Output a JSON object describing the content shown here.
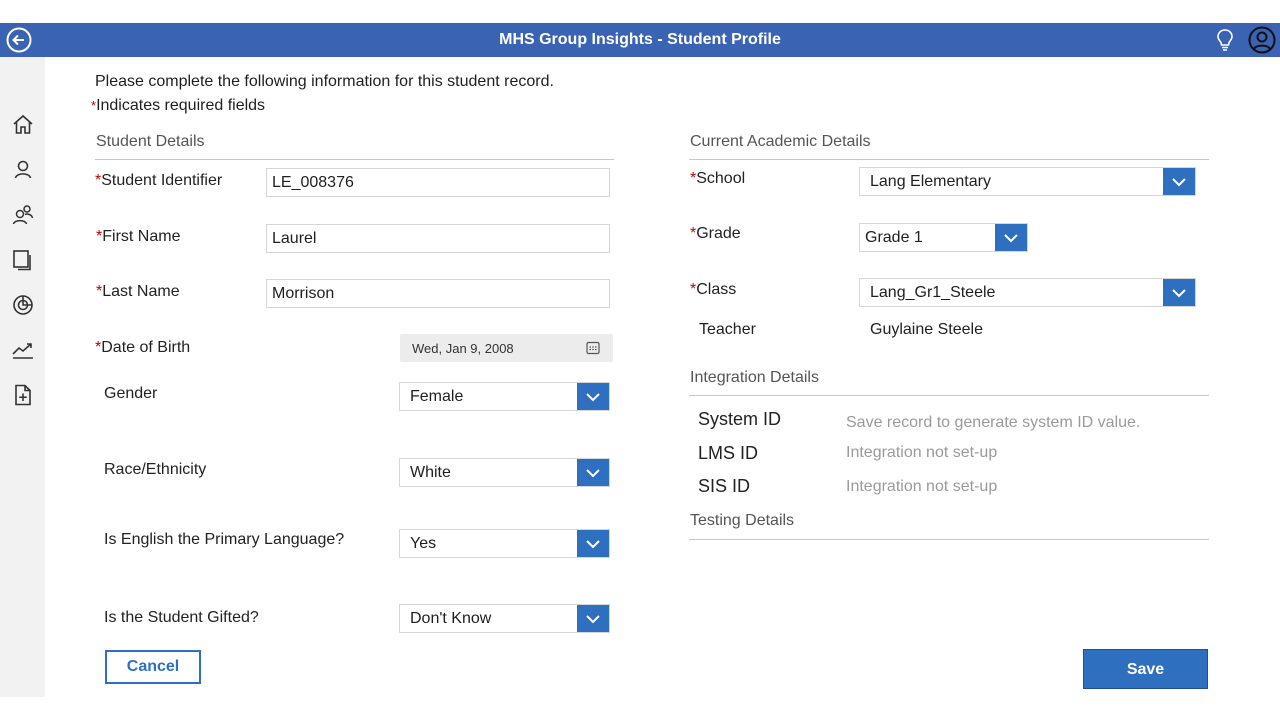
{
  "app": {
    "title": "MHS Group Insights - Student Profile"
  },
  "intro": {
    "line1": "Please complete the following information for this student record.",
    "required_mark": "*",
    "line2": "Indicates required fields"
  },
  "student_details": {
    "heading": "Student Details",
    "fields": {
      "student_identifier": {
        "label": "Student Identifier",
        "value": "LE_008376"
      },
      "first_name": {
        "label": "First Name",
        "value": "Laurel"
      },
      "last_name": {
        "label": "Last Name",
        "value": "Morrison"
      },
      "date_of_birth": {
        "label": "Date of Birth",
        "value": "Wed, Jan 9, 2008"
      },
      "gender": {
        "label": "Gender",
        "value": "Female"
      },
      "race": {
        "label": "Race/Ethnicity",
        "value": "White"
      },
      "english": {
        "label": "Is English the Primary Language?",
        "value": "Yes"
      },
      "gifted": {
        "label": "Is the Student Gifted?",
        "value": "Don't Know"
      }
    }
  },
  "academic": {
    "heading": "Current Academic Details",
    "school": {
      "label": "School",
      "value": "Lang Elementary"
    },
    "grade": {
      "label": "Grade",
      "value": "Grade 1"
    },
    "class": {
      "label": "Class",
      "value": "Lang_Gr1_Steele"
    },
    "teacher": {
      "label": "Teacher",
      "value": "Guylaine Steele"
    }
  },
  "integration": {
    "heading": "Integration Details",
    "system_id": {
      "label": "System ID",
      "value": "Save record to generate system ID value."
    },
    "lms_id": {
      "label": "LMS ID",
      "value": "Integration not set-up"
    },
    "sis_id": {
      "label": "SIS ID",
      "value": "Integration not set-up"
    }
  },
  "testing": {
    "heading": "Testing Details"
  },
  "buttons": {
    "cancel": "Cancel",
    "save": "Save"
  },
  "sidebar": {
    "icons": [
      "home-icon",
      "person-icon",
      "people-icon",
      "pages-icon",
      "target-icon",
      "trend-icon",
      "add-file-icon"
    ]
  },
  "colors": {
    "title_bar": "#3a63b4",
    "accent": "#2f6fbf",
    "required": "#c00000"
  }
}
